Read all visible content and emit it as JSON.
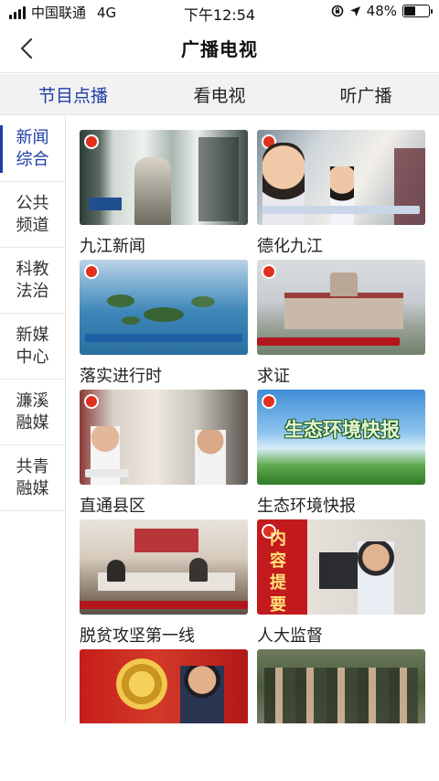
{
  "status_bar": {
    "carrier": "中国联通",
    "network": "4G",
    "time": "下午12:54",
    "battery": "48%",
    "battery_level": 0.48
  },
  "nav": {
    "title": "广播电视",
    "back_icon": "chevron-left-icon"
  },
  "tabs": [
    {
      "label": "节目点播",
      "active": true
    },
    {
      "label": "看电视",
      "active": false
    },
    {
      "label": "听广播",
      "active": false
    }
  ],
  "sidebar": {
    "items": [
      {
        "label": "新闻综合",
        "active": true
      },
      {
        "label": "公共频道",
        "active": false
      },
      {
        "label": "科教法治",
        "active": false
      },
      {
        "label": "新媒中心",
        "active": false
      },
      {
        "label": "濂溪融媒",
        "active": false
      },
      {
        "label": "共青融媒",
        "active": false
      }
    ]
  },
  "programs": [
    {
      "title": "九江新闻"
    },
    {
      "title": "德化九江"
    },
    {
      "title": "落实进行时"
    },
    {
      "title": "求证"
    },
    {
      "title": "直通县区"
    },
    {
      "title": "生态环境快报",
      "overlay": "生态环境快报"
    },
    {
      "title": "脱贫攻坚第一线"
    },
    {
      "title": "人大监督",
      "overlay": "内容提要"
    },
    {
      "title": ""
    },
    {
      "title": ""
    }
  ],
  "colors": {
    "accent": "#1d3ea6",
    "tab_bar": "#f2f2f2"
  }
}
